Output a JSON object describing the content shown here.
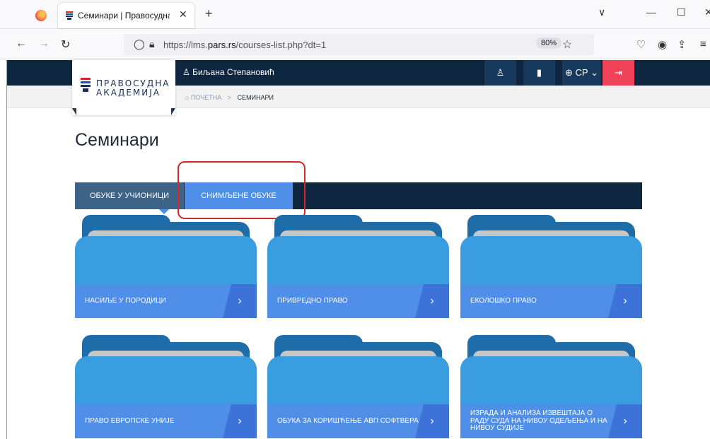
{
  "browser": {
    "tab_title": "Семинари | Правосудна Академ",
    "tab_close": "✕",
    "new_tab": "+",
    "url_prefix": "https://lms.",
    "url_domain": "pars.rs",
    "url_path": "/courses-list.php?dt=1",
    "zoom": "80%",
    "tab_list": "∨",
    "minimize": "—",
    "maximize": "☐",
    "close": "✕"
  },
  "site": {
    "logo_line1": "ПРАВОСУДНА",
    "logo_line2": "АКАДЕМИЈА",
    "user_name": "Биљана Степановић",
    "lang": "СР",
    "breadcrumb": {
      "home": "ПОЧЕТНА",
      "separator": ">",
      "current": "СЕМИНАРИ"
    },
    "page_title": "Семинари"
  },
  "tabs": [
    {
      "label": "ОБУКЕ У УЧИОНИЦИ",
      "active": false
    },
    {
      "label": "СНИМЉЕНЕ ОБУКЕ",
      "active": true
    }
  ],
  "cards": [
    {
      "label": "НАСИЉЕ У ПОРОДИЦИ"
    },
    {
      "label": "ПРИВРЕДНО ПРАВО"
    },
    {
      "label": "ЕКОЛОШКО ПРАВО"
    },
    {
      "label": "ПРАВО ЕВРОПСКЕ УНИЈЕ"
    },
    {
      "label": "ОБУКА ЗА КОРИШЋЕЊЕ АВП СОФТВЕРА"
    },
    {
      "label": "ИЗРАДА И АНАЛИЗА ИЗВЕШТАЈА О РАДУ СУДА НА НИВОУ ОДЕЉЕЊА И НА НИВОУ СУДИЈЕ"
    }
  ],
  "colors": {
    "navy": "#0f2640",
    "accent_blue": "#4f8fe8",
    "folder_blue": "#3a9ddf",
    "exit_red": "#f0435a",
    "highlight_red": "#d9262c"
  }
}
